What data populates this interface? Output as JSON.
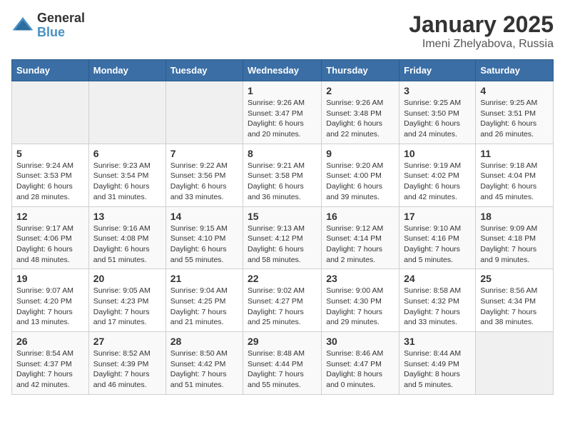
{
  "logo": {
    "general": "General",
    "blue": "Blue"
  },
  "title": {
    "month": "January 2025",
    "location": "Imeni Zhelyabova, Russia"
  },
  "weekdays": [
    "Sunday",
    "Monday",
    "Tuesday",
    "Wednesday",
    "Thursday",
    "Friday",
    "Saturday"
  ],
  "weeks": [
    [
      {
        "day": "",
        "info": ""
      },
      {
        "day": "",
        "info": ""
      },
      {
        "day": "",
        "info": ""
      },
      {
        "day": "1",
        "info": "Sunrise: 9:26 AM\nSunset: 3:47 PM\nDaylight: 6 hours\nand 20 minutes."
      },
      {
        "day": "2",
        "info": "Sunrise: 9:26 AM\nSunset: 3:48 PM\nDaylight: 6 hours\nand 22 minutes."
      },
      {
        "day": "3",
        "info": "Sunrise: 9:25 AM\nSunset: 3:50 PM\nDaylight: 6 hours\nand 24 minutes."
      },
      {
        "day": "4",
        "info": "Sunrise: 9:25 AM\nSunset: 3:51 PM\nDaylight: 6 hours\nand 26 minutes."
      }
    ],
    [
      {
        "day": "5",
        "info": "Sunrise: 9:24 AM\nSunset: 3:53 PM\nDaylight: 6 hours\nand 28 minutes."
      },
      {
        "day": "6",
        "info": "Sunrise: 9:23 AM\nSunset: 3:54 PM\nDaylight: 6 hours\nand 31 minutes."
      },
      {
        "day": "7",
        "info": "Sunrise: 9:22 AM\nSunset: 3:56 PM\nDaylight: 6 hours\nand 33 minutes."
      },
      {
        "day": "8",
        "info": "Sunrise: 9:21 AM\nSunset: 3:58 PM\nDaylight: 6 hours\nand 36 minutes."
      },
      {
        "day": "9",
        "info": "Sunrise: 9:20 AM\nSunset: 4:00 PM\nDaylight: 6 hours\nand 39 minutes."
      },
      {
        "day": "10",
        "info": "Sunrise: 9:19 AM\nSunset: 4:02 PM\nDaylight: 6 hours\nand 42 minutes."
      },
      {
        "day": "11",
        "info": "Sunrise: 9:18 AM\nSunset: 4:04 PM\nDaylight: 6 hours\nand 45 minutes."
      }
    ],
    [
      {
        "day": "12",
        "info": "Sunrise: 9:17 AM\nSunset: 4:06 PM\nDaylight: 6 hours\nand 48 minutes."
      },
      {
        "day": "13",
        "info": "Sunrise: 9:16 AM\nSunset: 4:08 PM\nDaylight: 6 hours\nand 51 minutes."
      },
      {
        "day": "14",
        "info": "Sunrise: 9:15 AM\nSunset: 4:10 PM\nDaylight: 6 hours\nand 55 minutes."
      },
      {
        "day": "15",
        "info": "Sunrise: 9:13 AM\nSunset: 4:12 PM\nDaylight: 6 hours\nand 58 minutes."
      },
      {
        "day": "16",
        "info": "Sunrise: 9:12 AM\nSunset: 4:14 PM\nDaylight: 7 hours\nand 2 minutes."
      },
      {
        "day": "17",
        "info": "Sunrise: 9:10 AM\nSunset: 4:16 PM\nDaylight: 7 hours\nand 5 minutes."
      },
      {
        "day": "18",
        "info": "Sunrise: 9:09 AM\nSunset: 4:18 PM\nDaylight: 7 hours\nand 9 minutes."
      }
    ],
    [
      {
        "day": "19",
        "info": "Sunrise: 9:07 AM\nSunset: 4:20 PM\nDaylight: 7 hours\nand 13 minutes."
      },
      {
        "day": "20",
        "info": "Sunrise: 9:05 AM\nSunset: 4:23 PM\nDaylight: 7 hours\nand 17 minutes."
      },
      {
        "day": "21",
        "info": "Sunrise: 9:04 AM\nSunset: 4:25 PM\nDaylight: 7 hours\nand 21 minutes."
      },
      {
        "day": "22",
        "info": "Sunrise: 9:02 AM\nSunset: 4:27 PM\nDaylight: 7 hours\nand 25 minutes."
      },
      {
        "day": "23",
        "info": "Sunrise: 9:00 AM\nSunset: 4:30 PM\nDaylight: 7 hours\nand 29 minutes."
      },
      {
        "day": "24",
        "info": "Sunrise: 8:58 AM\nSunset: 4:32 PM\nDaylight: 7 hours\nand 33 minutes."
      },
      {
        "day": "25",
        "info": "Sunrise: 8:56 AM\nSunset: 4:34 PM\nDaylight: 7 hours\nand 38 minutes."
      }
    ],
    [
      {
        "day": "26",
        "info": "Sunrise: 8:54 AM\nSunset: 4:37 PM\nDaylight: 7 hours\nand 42 minutes."
      },
      {
        "day": "27",
        "info": "Sunrise: 8:52 AM\nSunset: 4:39 PM\nDaylight: 7 hours\nand 46 minutes."
      },
      {
        "day": "28",
        "info": "Sunrise: 8:50 AM\nSunset: 4:42 PM\nDaylight: 7 hours\nand 51 minutes."
      },
      {
        "day": "29",
        "info": "Sunrise: 8:48 AM\nSunset: 4:44 PM\nDaylight: 7 hours\nand 55 minutes."
      },
      {
        "day": "30",
        "info": "Sunrise: 8:46 AM\nSunset: 4:47 PM\nDaylight: 8 hours\nand 0 minutes."
      },
      {
        "day": "31",
        "info": "Sunrise: 8:44 AM\nSunset: 4:49 PM\nDaylight: 8 hours\nand 5 minutes."
      },
      {
        "day": "",
        "info": ""
      }
    ]
  ]
}
